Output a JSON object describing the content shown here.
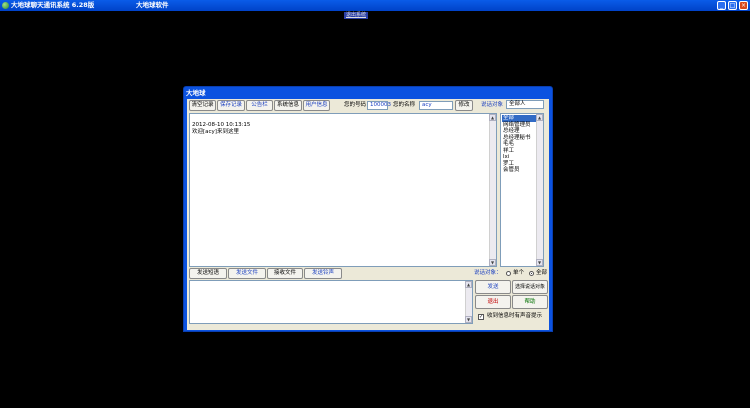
{
  "window": {
    "title": "大地球聊天通讯系统 6.28版",
    "company": "大地球软件",
    "top_link": "退出系统"
  },
  "dialog": {
    "title": "大地球",
    "toolbar": {
      "clear": "清空记录",
      "save": "保存记录",
      "bulletin": "公告栏",
      "system_msg": "系统信息",
      "user_info": "用户信息"
    },
    "your_number_label": "您的号码",
    "your_number": "100003",
    "your_name_label": "您的名称",
    "your_name": "acy",
    "rename": "修改",
    "target_label": "说话对象",
    "target_value": "全部人",
    "messages": [
      "2012-08-10 10:13:15",
      "欢迎[acy]来到这里"
    ],
    "users": [
      "全部",
      "网络管理员",
      "总经理",
      "总经理秘书",
      "毛毛",
      "祥工",
      "lxi",
      "罗工",
      "会管员"
    ],
    "actions": {
      "send_phrase": "发送短语",
      "send_file": "发送文件",
      "receive_file": "接收文件",
      "send_ringtone": "发送铃声"
    },
    "talk_target_label": "说话对象：",
    "single_label": "单个",
    "all_label": "全部",
    "send": "发送",
    "choose_target": "选择说话对象",
    "exit": "退出",
    "help": "帮助",
    "sound_prompt": "收到信息时有声音提示",
    "check_mark": "✓"
  }
}
